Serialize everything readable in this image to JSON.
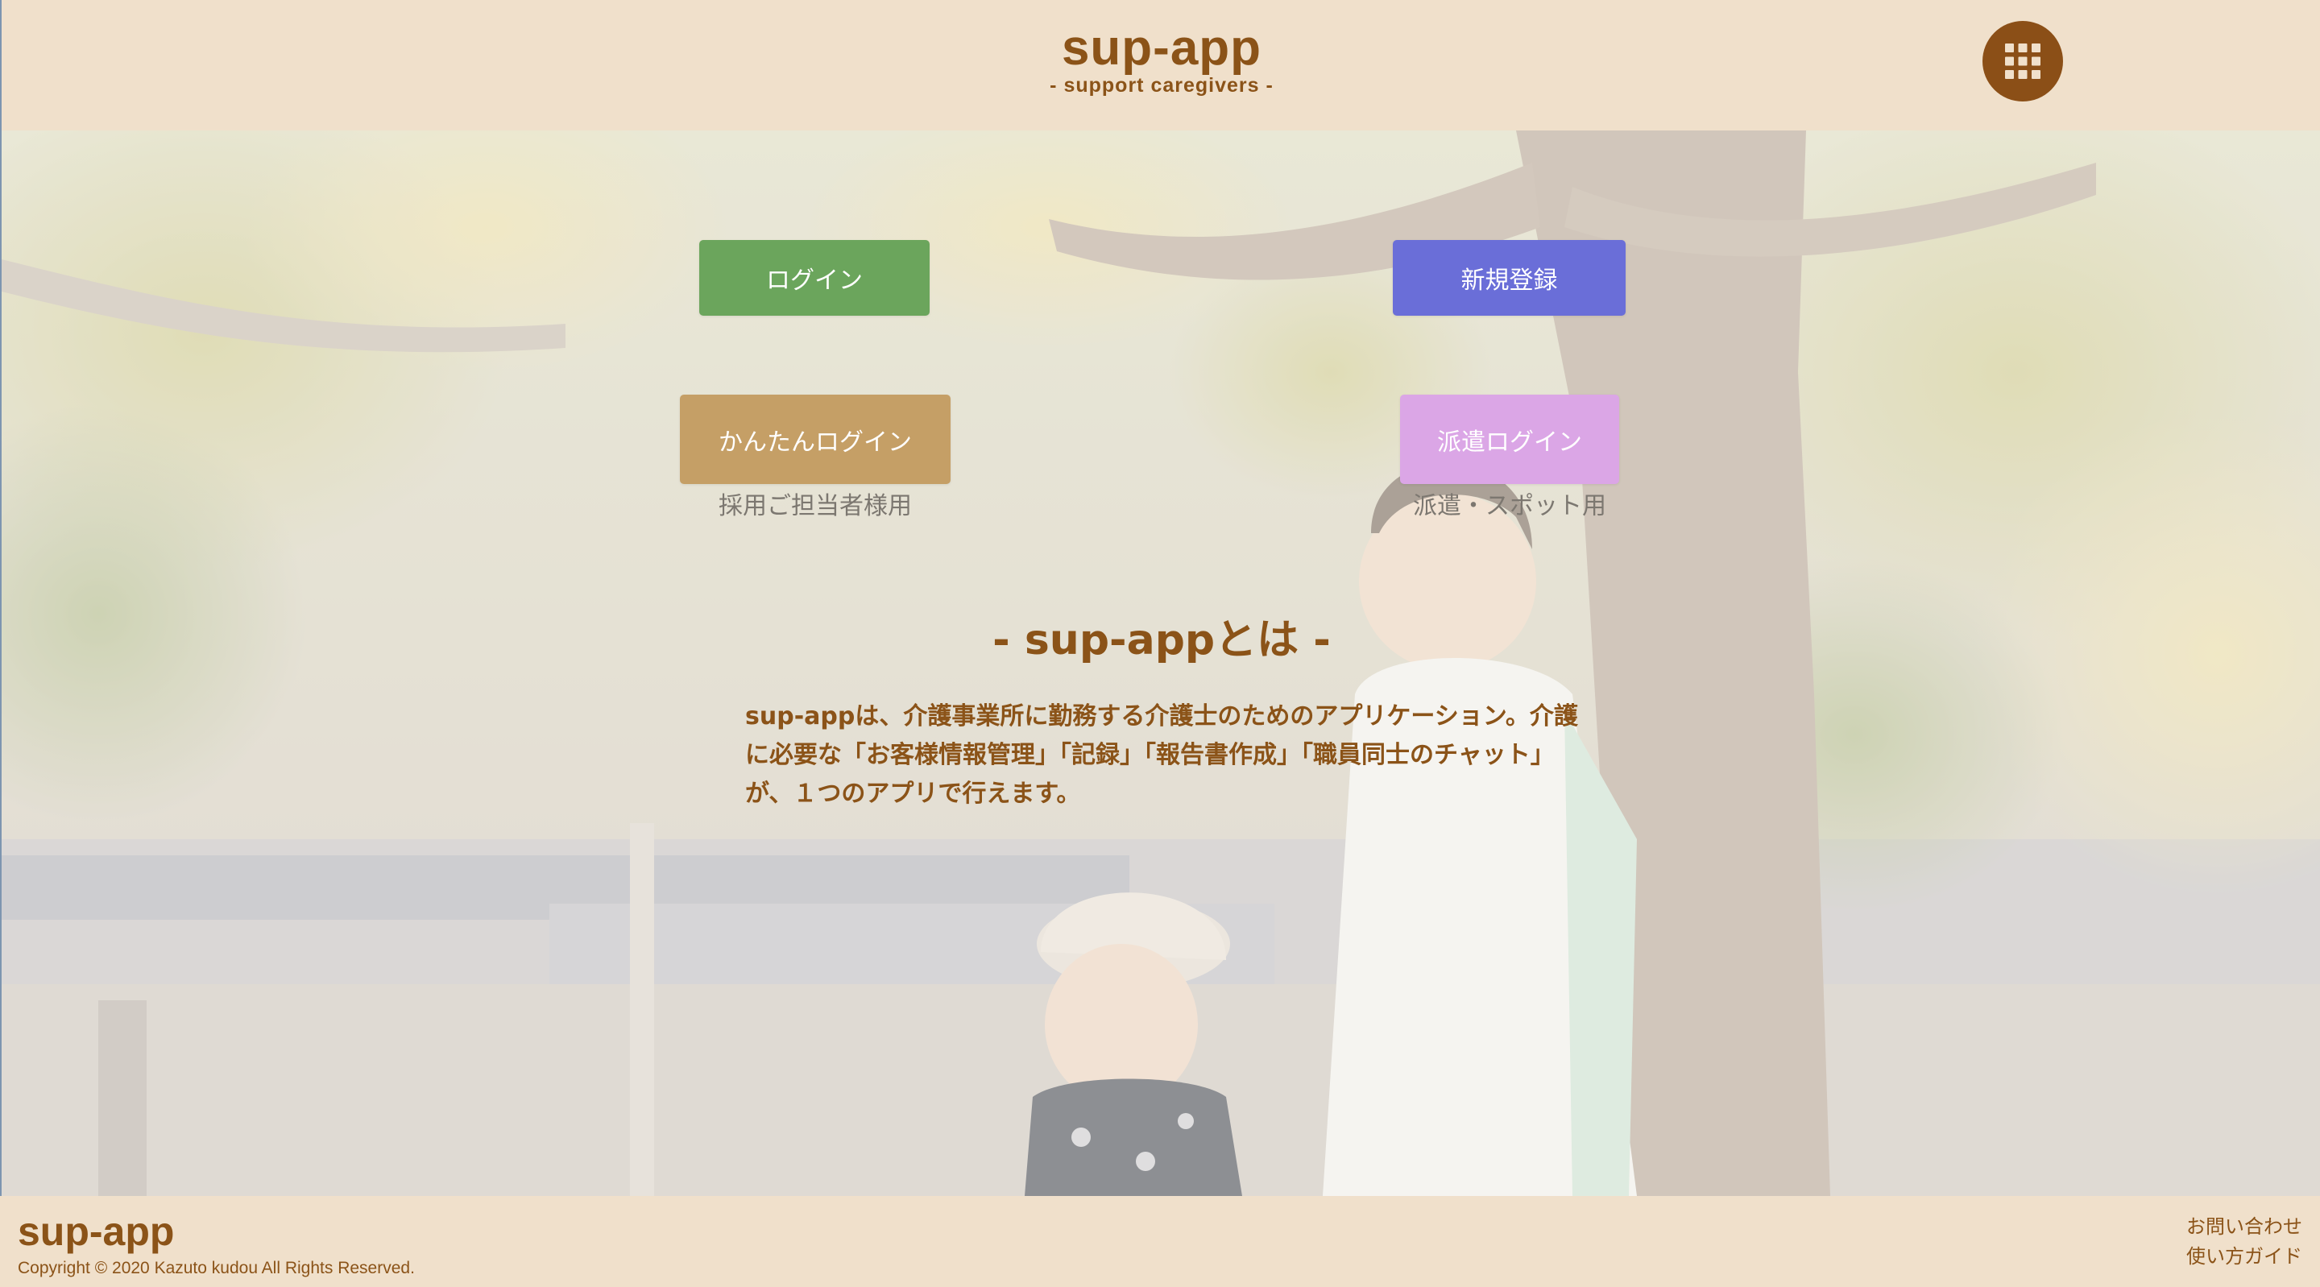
{
  "header": {
    "brand_title": "sup-app",
    "brand_subtitle": "- support caregivers -",
    "menu_icon": "grid-icon"
  },
  "hero": {
    "buttons": {
      "login": "ログイン",
      "register": "新規登録",
      "easy_login": "かんたんログイン",
      "dispatch_login": "派遣ログイン"
    },
    "notes": {
      "easy_login": "採用ご担当者様用",
      "dispatch_login": "派遣・スポット用"
    },
    "about": {
      "title": "- sup-appとは -",
      "text": "sup-appは、介護事業所に勤務する介護士のためのアプリケーション。介護に必要な「お客様情報管理」「記録」「報告書作成」「職員同士のチャット」が、１つのアプリで行えます。"
    }
  },
  "footer": {
    "brand": "sup-app",
    "copyright": "Copyright © 2020 Kazuto kudou All Rights Reserved.",
    "links": [
      "お問い合わせ",
      "使い方ガイド"
    ]
  },
  "colors": {
    "brand_brown": "#8b5318",
    "header_bg": "#f0e0cb",
    "login_green": "#6ba55c",
    "register_blue": "#6a6ed8",
    "easy_tan": "#c59f66",
    "dispatch_pink": "#dba6e6"
  }
}
